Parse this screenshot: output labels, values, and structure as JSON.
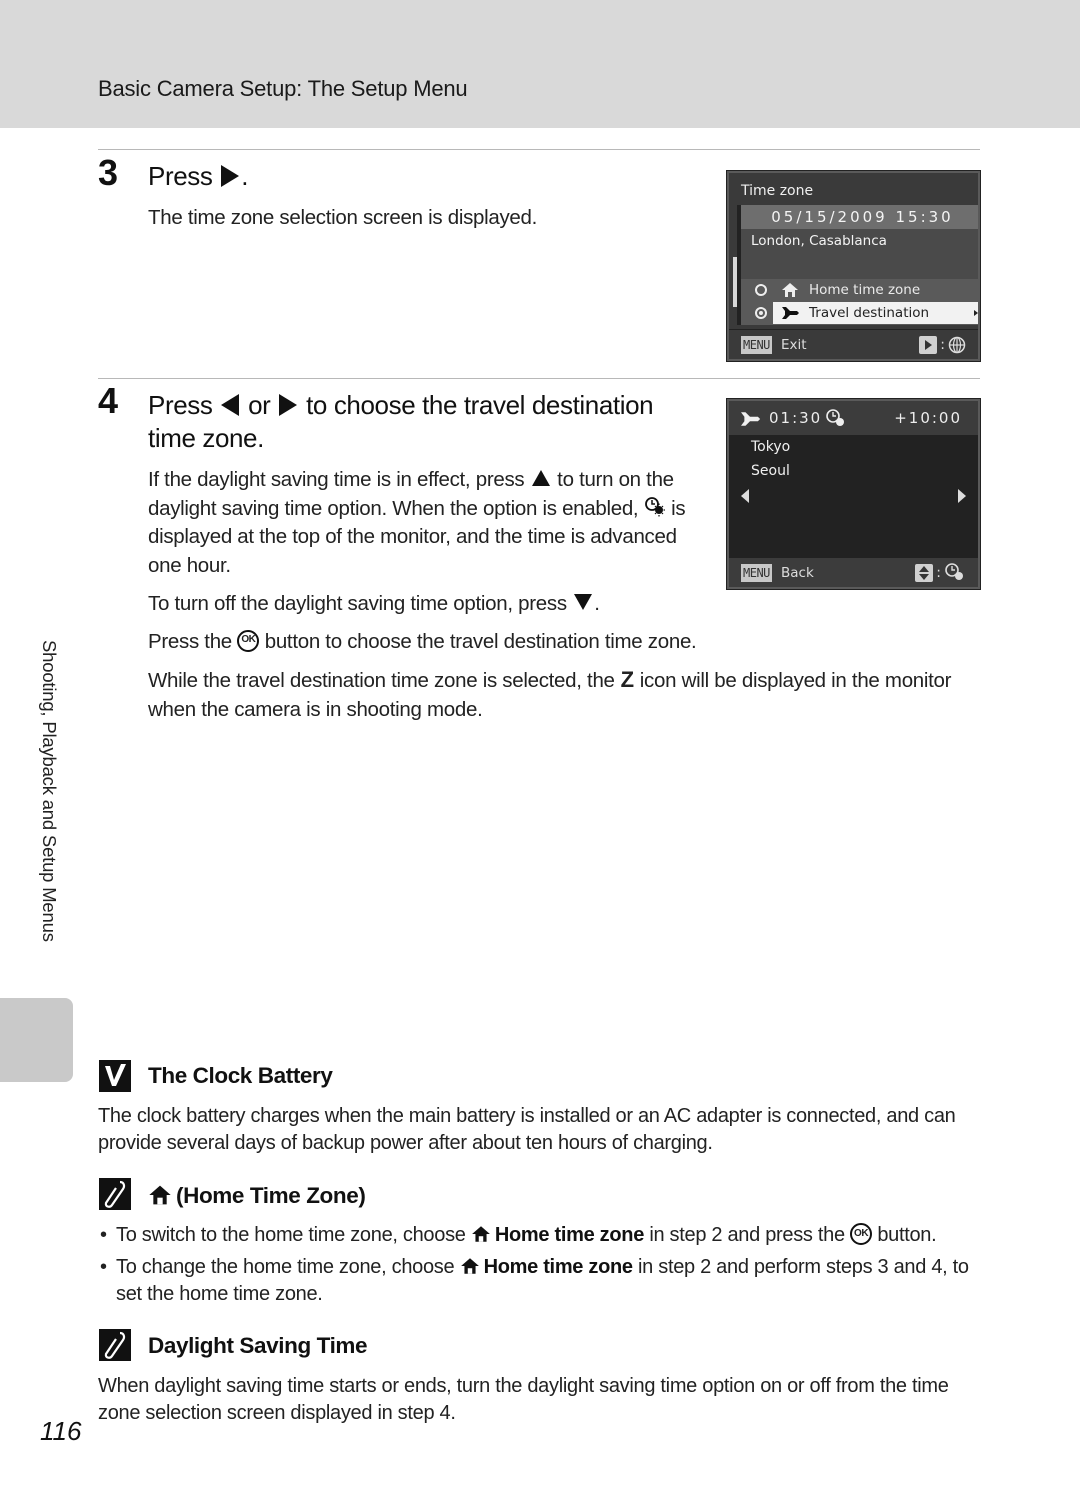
{
  "header": {
    "title": "Basic Camera Setup: The Setup Menu",
    "band_color": "#d9d9d9"
  },
  "side_tab": {
    "label": "Shooting, Playback and Setup Menus"
  },
  "step3": {
    "number": "3",
    "heading_prefix": "Press",
    "heading_suffix": ".",
    "heading_key_icon": "multi-selector-right-icon",
    "body": "The time zone selection screen is displayed."
  },
  "screen1": {
    "title": "Time zone",
    "datetime": "05/15/2009  15:30",
    "city": "London, Casablanca",
    "options": [
      {
        "label": "Home time zone",
        "icon": "home-icon",
        "selected": false,
        "highlighted": false
      },
      {
        "label": "Travel destination",
        "icon": "airplane-icon",
        "selected": true,
        "highlighted": true
      }
    ],
    "footer_key": "MENU",
    "footer_label": "Exit",
    "footer_right_icons": [
      "multi-selector-right-icon",
      "globe-icon"
    ]
  },
  "step4": {
    "number": "4",
    "heading_line1_prefix": "Press",
    "heading_line1_or": "or",
    "heading_line1_suffix": "to choose the travel destination",
    "heading_line2": "time zone.",
    "para1_a": "If the daylight saving time is in effect, press",
    "para1_b": "to turn on the daylight saving time option. When the option is enabled,",
    "para1_c": "is displayed at the top of the monitor, and the time is advanced one hour.",
    "para2_a": "To turn off the daylight saving time option, press",
    "para2_b": ".",
    "para3_a": "Press the",
    "para3_b": "button to choose the travel destination time zone.",
    "ok_label": "OK",
    "para4_a": "While the travel destination time zone is selected, the",
    "para4_icon_glyph": "Z",
    "para4_b": "icon will be displayed in the monitor when the camera is in shooting mode."
  },
  "screen2": {
    "time": "01:30",
    "offset": "+10:00",
    "cities": [
      "Tokyo",
      "Seoul"
    ],
    "footer_key": "MENU",
    "footer_label": "Back",
    "footer_right_icons": [
      "multi-selector-up-down-icon",
      "daylight-saving-icon"
    ]
  },
  "notes": {
    "clock_battery": {
      "icon": "check-icon",
      "title": "The Clock Battery",
      "body": "The clock battery charges when the main battery is installed or an AC adapter is connected, and can provide several days of backup power after about ten hours of charging."
    },
    "home_time_zone": {
      "icon": "pencil-note-icon",
      "title": "(Home Time Zone)",
      "bullets": [
        {
          "a": "To switch to the home time zone, choose",
          "bold": "Home time zone",
          "b": "in step 2 and press the",
          "c": "button."
        },
        {
          "a": "To change the home time zone, choose",
          "bold": "Home time zone",
          "b": "in step 2 and perform steps 3 and 4, to set the home time zone."
        }
      ]
    },
    "daylight_saving": {
      "icon": "pencil-note-icon",
      "title": "Daylight Saving Time",
      "body": "When daylight saving time starts or ends, turn the daylight saving time option on or off from the time zone selection screen displayed in step 4."
    }
  },
  "page_number": "116"
}
